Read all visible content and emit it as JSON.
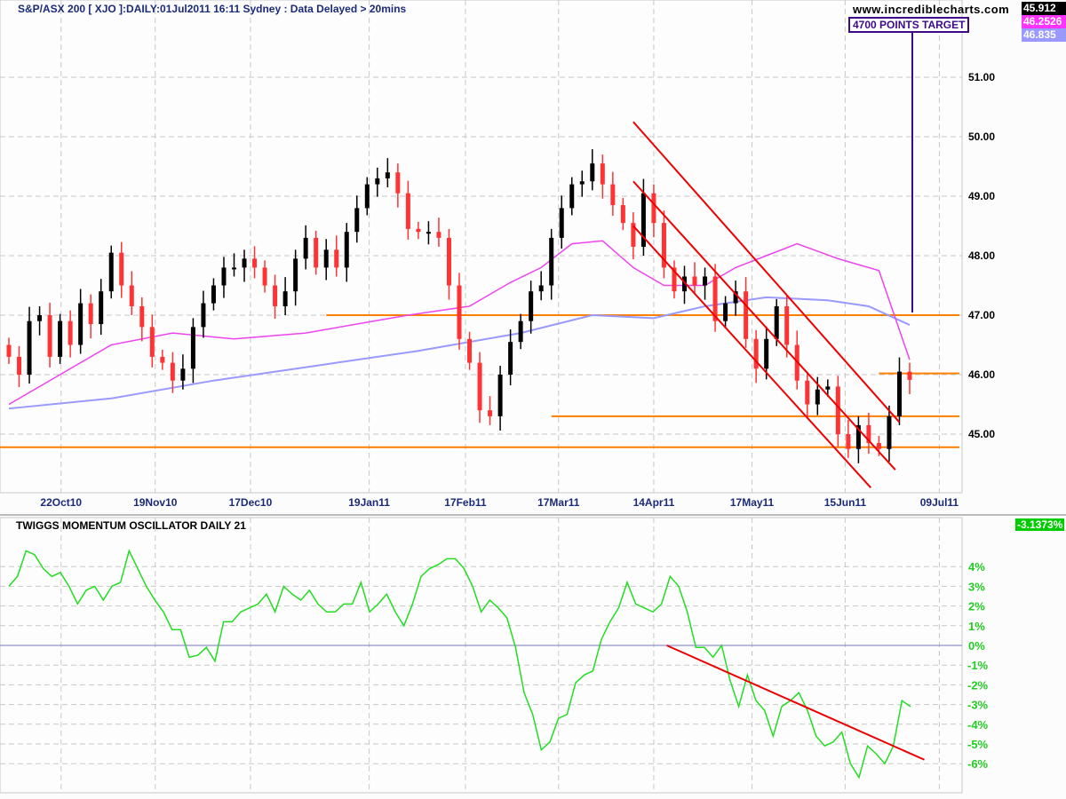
{
  "header": {
    "title": "S&P/ASX 200 [ XJO ]:DAILY:01Jul2011 16:11 Sydney : Data Delayed > 20mins",
    "website": "www.incrediblecharts.com",
    "annotation": "4700 POINTS TARGET"
  },
  "badges": [
    {
      "text": "45.912",
      "bg": "#000000",
      "fg": "#ffffff"
    },
    {
      "text": "46.2526",
      "bg": "#ff33ff",
      "fg": "#ffffff"
    },
    {
      "text": "46.835",
      "bg": "#9999ff",
      "fg": "#ffffff"
    }
  ],
  "osc_badge": {
    "text": "-3.1373%",
    "bg": "#00cc00",
    "fg": "#ffffff"
  },
  "colors": {
    "up": "#000000",
    "down": "#ff3333",
    "ma_short": "#ee44ee",
    "ma_long": "#9999ff",
    "support": "#ff8000",
    "channel": "#ee0000",
    "osc": "#22dd22",
    "target": "#3d0a8a"
  },
  "chart_data": [
    {
      "type": "candlestick",
      "title": "S&P/ASX 200 [ XJO ] DAILY",
      "ylim": [
        44.2,
        51.6
      ],
      "yticks": [
        "45.00",
        "46.00",
        "47.00",
        "48.00",
        "49.00",
        "50.00",
        "51.00"
      ],
      "ytick_values": [
        45,
        46,
        47,
        48,
        49,
        50,
        51
      ],
      "xticks": [
        {
          "label": "22Oct10",
          "index": 5.1
        },
        {
          "label": "19Nov10",
          "index": 14.3
        },
        {
          "label": "17Dec10",
          "index": 23.6
        },
        {
          "label": "19Jan11",
          "index": 35.2
        },
        {
          "label": "17Feb11",
          "index": 44.6
        },
        {
          "label": "17Mar11",
          "index": 53.7
        },
        {
          "label": "14Apr11",
          "index": 63.0
        },
        {
          "label": "17May11",
          "index": 72.6
        },
        {
          "label": "15Jun11",
          "index": 81.7
        },
        {
          "label": "09Jul11",
          "index": 90.9
        }
      ],
      "closes": [
        46.3,
        46.0,
        46.9,
        47.0,
        46.3,
        46.9,
        46.5,
        47.2,
        46.85,
        47.4,
        48.05,
        47.5,
        47.15,
        46.8,
        46.3,
        46.2,
        45.9,
        46.1,
        46.8,
        47.2,
        47.5,
        47.8,
        47.8,
        47.95,
        47.8,
        47.5,
        47.15,
        47.4,
        47.95,
        48.3,
        47.8,
        48.1,
        47.8,
        48.4,
        48.8,
        49.2,
        49.3,
        49.4,
        49.05,
        48.45,
        48.4,
        48.4,
        48.3,
        47.5,
        46.6,
        46.2,
        45.4,
        45.3,
        46.0,
        46.55,
        46.9,
        47.4,
        47.5,
        48.3,
        48.8,
        49.2,
        49.25,
        49.55,
        49.2,
        48.85,
        48.55,
        48.15,
        49.05,
        48.55,
        47.8,
        47.4,
        47.65,
        47.5,
        47.65,
        46.9,
        47.2,
        47.4,
        46.6,
        46.1,
        46.6,
        47.15,
        46.5,
        45.9,
        45.5,
        45.75,
        45.8,
        45.0,
        44.75,
        45.15,
        44.85,
        44.75,
        45.3,
        46.05,
        45.912
      ],
      "ma_short": {
        "label": "46.2526",
        "index": [
          0,
          10,
          16,
          22,
          29,
          34,
          39,
          45,
          49,
          52,
          55,
          58,
          61,
          64,
          68,
          71,
          74,
          77,
          81,
          85,
          88
        ],
        "values": [
          45.5,
          46.5,
          46.7,
          46.6,
          46.7,
          46.85,
          47.0,
          47.15,
          47.55,
          47.8,
          48.2,
          48.25,
          47.8,
          47.5,
          47.5,
          47.8,
          48.0,
          48.2,
          47.95,
          47.75,
          46.25
        ]
      },
      "ma_long": {
        "label": "46.835",
        "index": [
          0,
          10,
          20,
          30,
          40,
          50,
          57,
          63,
          68,
          74,
          80,
          84,
          88
        ],
        "values": [
          45.43,
          45.6,
          45.9,
          46.15,
          46.4,
          46.7,
          47.0,
          46.95,
          47.15,
          47.3,
          47.25,
          47.15,
          46.835
        ]
      },
      "horizontal_lines": [
        {
          "value": 47.0,
          "from_index": 31
        },
        {
          "value": 46.02,
          "from_index": 85
        },
        {
          "value": 45.3,
          "from_index": 53
        },
        {
          "value": 44.78,
          "from_index": -1
        }
      ],
      "channel_lines": [
        {
          "from": [
            61,
            50.25
          ],
          "to": [
            87,
            45.2
          ]
        },
        {
          "from": [
            61,
            49.25
          ],
          "to": [
            86.6,
            44.4
          ]
        },
        {
          "from": [
            61,
            48.5
          ],
          "to": [
            84.2,
            44.1
          ]
        }
      ],
      "target_line": {
        "from_value": 47.0,
        "to_label": "4700 POINTS TARGET"
      }
    },
    {
      "type": "line",
      "title": "TWIGGS MOMENTUM OSCILLATOR DAILY 21",
      "ylim": [
        -7.4,
        6.0
      ],
      "yticks": [
        "4%",
        "3%",
        "2%",
        "1%",
        "0%",
        "-1%",
        "-2%",
        "-3%",
        "-4%",
        "-5%",
        "-6%"
      ],
      "ytick_values": [
        4,
        3,
        2,
        1,
        0,
        -1,
        -2,
        -3,
        -4,
        -5,
        -6
      ],
      "values": [
        3.0,
        3.5,
        4.8,
        4.6,
        3.9,
        3.5,
        3.7,
        3.0,
        2.1,
        2.8,
        3.0,
        2.3,
        3.0,
        3.2,
        4.8,
        3.9,
        3.0,
        2.3,
        1.7,
        0.8,
        0.8,
        -0.6,
        -0.5,
        -0.1,
        -0.8,
        1.2,
        1.2,
        1.7,
        1.9,
        2.1,
        2.6,
        1.7,
        3.0,
        2.6,
        2.3,
        2.8,
        2.1,
        1.7,
        1.7,
        2.1,
        2.1,
        3.2,
        1.7,
        2.1,
        2.6,
        1.7,
        1.0,
        2.1,
        3.5,
        3.9,
        4.1,
        4.4,
        4.4,
        3.9,
        3.0,
        1.7,
        2.3,
        1.9,
        1.4,
        -0.1,
        -2.4,
        -3.5,
        -5.3,
        -4.9,
        -3.7,
        -3.5,
        -1.9,
        -1.5,
        -1.3,
        0.3,
        1.2,
        1.9,
        3.2,
        2.1,
        1.9,
        1.7,
        2.1,
        3.5,
        3.0,
        1.7,
        -0.1,
        -0.1,
        -0.6,
        0.0,
        -1.8,
        -3.1,
        -1.5,
        -2.8,
        -3.3,
        -4.6,
        -3.1,
        -2.8,
        -2.4,
        -3.3,
        -4.6,
        -5.1,
        -4.9,
        -4.4,
        -6.0,
        -6.7,
        -5.1,
        -5.5,
        -6.0,
        -5.1,
        -2.8,
        -3.1
      ],
      "trend_line": {
        "from": [
          0.715,
          0.0
        ],
        "to": [
          0.995,
          -5.8
        ]
      }
    }
  ]
}
